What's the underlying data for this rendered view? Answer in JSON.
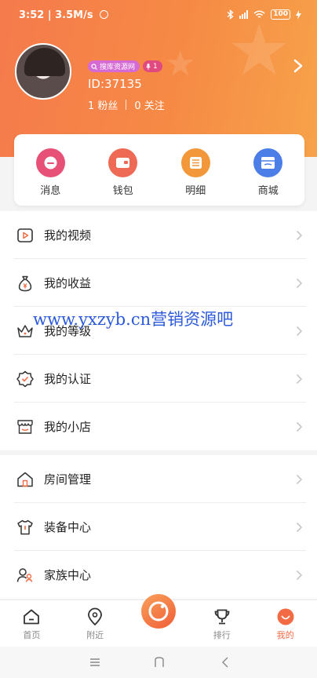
{
  "status": {
    "time_speed": "3:52 | 3.5M/s",
    "battery": "100"
  },
  "profile": {
    "badge_level": "搜库资源网",
    "badge_fans": "1",
    "user_id": "ID:37135",
    "fans": "1 粉丝",
    "follow": "0 关注",
    "colors": {
      "header_start": "#f57a4c",
      "header_end": "#f7a24a"
    }
  },
  "quick_actions": [
    {
      "label": "消息",
      "icon": "message-icon",
      "color": "#e75077"
    },
    {
      "label": "钱包",
      "icon": "wallet-icon",
      "color": "#ef6a55"
    },
    {
      "label": "明细",
      "icon": "detail-list-icon",
      "color": "#f2983a"
    },
    {
      "label": "商城",
      "icon": "store-icon",
      "color": "#4c7ee8"
    }
  ],
  "menu_group_1": [
    {
      "label": "我的视频",
      "icon": "video-icon"
    },
    {
      "label": "我的收益",
      "icon": "money-bag-icon"
    },
    {
      "label": "我的等级",
      "icon": "crown-icon"
    },
    {
      "label": "我的认证",
      "icon": "verified-badge-icon"
    },
    {
      "label": "我的小店",
      "icon": "shop-icon"
    }
  ],
  "menu_group_2": [
    {
      "label": "房间管理",
      "icon": "house-icon"
    },
    {
      "label": "装备中心",
      "icon": "shirt-icon"
    },
    {
      "label": "家族中心",
      "icon": "family-icon"
    }
  ],
  "watermark": "www.yxzyb.cn营销资源吧",
  "tabs": [
    {
      "label": "首页",
      "icon": "home-icon"
    },
    {
      "label": "附近",
      "icon": "location-icon"
    },
    {
      "label": "",
      "icon": "live-camera-icon"
    },
    {
      "label": "排行",
      "icon": "trophy-icon"
    },
    {
      "label": "我的",
      "icon": "profile-face-icon",
      "active": true
    }
  ],
  "accent": "#f26b45"
}
